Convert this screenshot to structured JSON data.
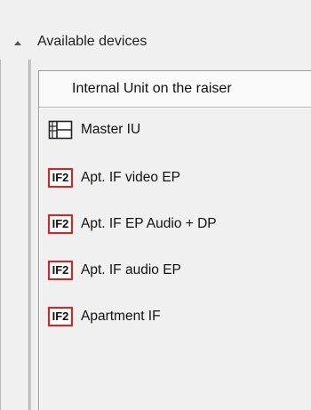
{
  "section": {
    "title": "Available devices",
    "collapse_icon": "caret-up-icon"
  },
  "panel": {
    "header": "Internal Unit on the raiser",
    "items": [
      {
        "label": "Master IU",
        "icon": "master-iu-icon"
      },
      {
        "label": "Apt. IF video EP",
        "icon": "if2-icon",
        "badge": "IF2"
      },
      {
        "label": "Apt. IF EP Audio + DP",
        "icon": "if2-icon",
        "badge": "IF2"
      },
      {
        "label": "Apt. IF audio EP",
        "icon": "if2-icon",
        "badge": "IF2"
      },
      {
        "label": "Apartment IF",
        "icon": "if2-icon",
        "badge": "IF2"
      }
    ]
  },
  "colors": {
    "badge_border": "#e0201f",
    "background": "#f0f0f0"
  }
}
